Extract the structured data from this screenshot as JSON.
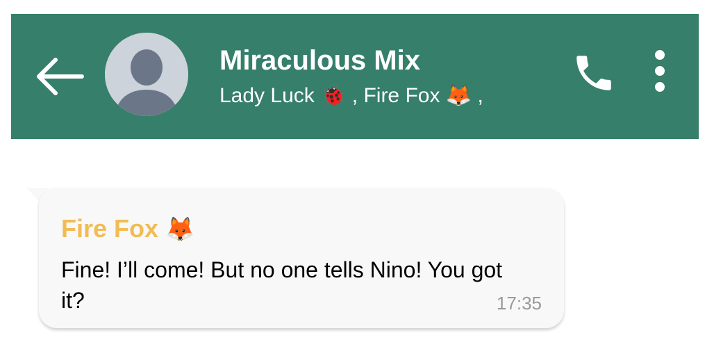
{
  "header": {
    "group_name": "Miraculous Mix",
    "members_text": "Lady Luck 🐞 , Fire Fox 🦊 ,",
    "background_color": "#367f6a",
    "back_icon": "back-arrow-icon",
    "call_icon": "phone-icon",
    "more_icon": "more-vertical-icon"
  },
  "message": {
    "sender": "Fire Fox",
    "sender_emoji": "🦊",
    "sender_color": "#f1bc54",
    "text": "Fine! I’ll come! But no one tells Nino! You got it?",
    "time": "17:35"
  }
}
